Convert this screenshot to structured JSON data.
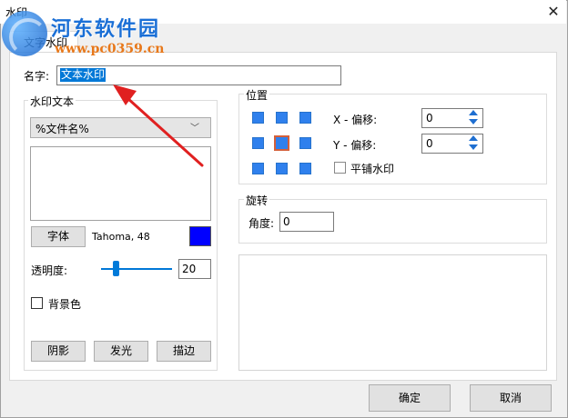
{
  "window": {
    "title": "水印"
  },
  "logo": {
    "name": "河东软件园",
    "url": "www.pc0359.cn"
  },
  "tab": {
    "label": "文字水印"
  },
  "name_field": {
    "label": "名字:",
    "value": "文本水印"
  },
  "watermark_text": {
    "group_title": "水印文本",
    "variable_combo": {
      "selected": "%文件名%"
    },
    "text_value": "",
    "font_button": "字体",
    "font_info": "Tahoma, 48",
    "color": "#0000ff",
    "opacity": {
      "label": "透明度:",
      "value": "20",
      "level": 20
    },
    "background_color": {
      "label": "背景色",
      "checked": false
    },
    "buttons": {
      "shadow": "阴影",
      "glow": "发光",
      "stroke": "描边"
    }
  },
  "position": {
    "group_title": "位置",
    "grid": {
      "rows": 3,
      "cols": 3,
      "selected": [
        1,
        1
      ]
    },
    "x_offset": {
      "label": "X - 偏移:",
      "value": "0"
    },
    "y_offset": {
      "label": "Y - 偏移:",
      "value": "0"
    },
    "tile": {
      "label": "平铺水印",
      "checked": false
    }
  },
  "rotation": {
    "group_title": "旋转",
    "angle": {
      "label": "角度:",
      "value": "0"
    }
  },
  "footer": {
    "ok": "确定",
    "cancel": "取消"
  },
  "colors": {
    "accent": "#0078d7",
    "grid_dot": "#2f80ed",
    "selected_border": "#d4603a",
    "annotation_arrow": "#e02020"
  }
}
